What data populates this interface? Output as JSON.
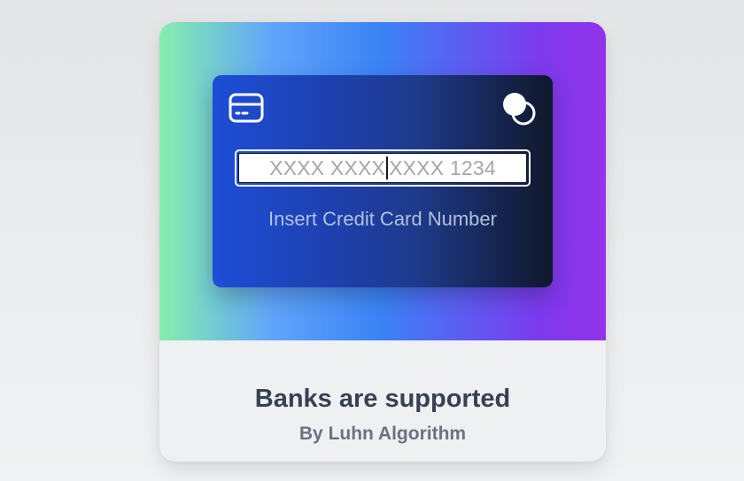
{
  "card": {
    "number_placeholder_before_caret": "XXXX XXXX",
    "number_placeholder_after_caret": "XXXX 1234",
    "field_label": "Insert Credit Card Number",
    "icons": {
      "card": "credit-card-icon",
      "network": "card-network-icon"
    }
  },
  "caption": {
    "title": "Banks are supported",
    "subtitle": "By Luhn Algorithm"
  },
  "colors": {
    "gradient": [
      "#86efac",
      "#3b82f6",
      "#9333ea"
    ],
    "card_gradient": [
      "#1d4ed8",
      "#0f172a"
    ],
    "title": "#374151",
    "subtitle": "#6b7280"
  }
}
